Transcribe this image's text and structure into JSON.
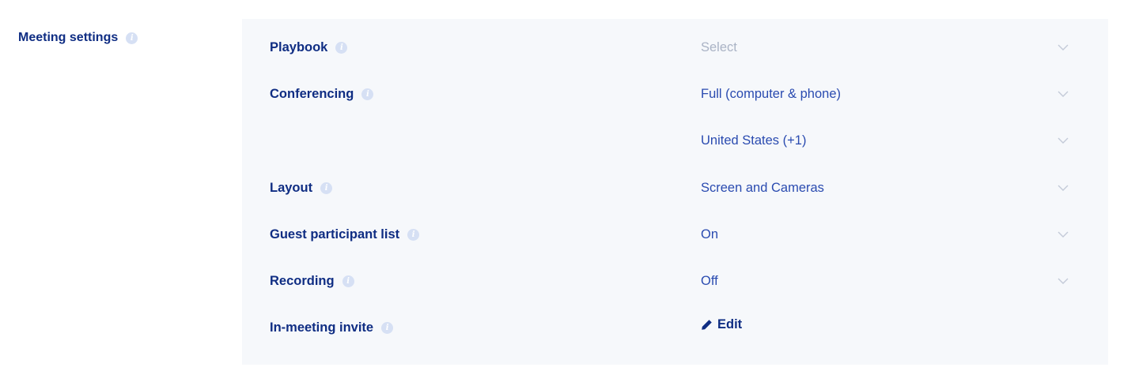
{
  "section": {
    "title": "Meeting settings",
    "info_icon": "info-icon"
  },
  "rows": {
    "playbook": {
      "label": "Playbook",
      "value": "Select"
    },
    "conferencing": {
      "label": "Conferencing",
      "value": "Full (computer & phone)"
    },
    "country": {
      "label": "",
      "value": "United States (+1)"
    },
    "layout": {
      "label": "Layout",
      "value": "Screen and Cameras"
    },
    "guest_list": {
      "label": "Guest participant list",
      "value": "On"
    },
    "recording": {
      "label": "Recording",
      "value": "Off"
    },
    "invite": {
      "label": "In-meeting invite",
      "action": "Edit",
      "icon": "pencil-icon"
    }
  },
  "colors": {
    "label": "#0f2d83",
    "value": "#2a4bb0",
    "placeholder": "#aab3c5",
    "panel_bg": "#f6f8fb",
    "info_icon": "#d6e0f4",
    "chevron": "#c3cad8"
  }
}
